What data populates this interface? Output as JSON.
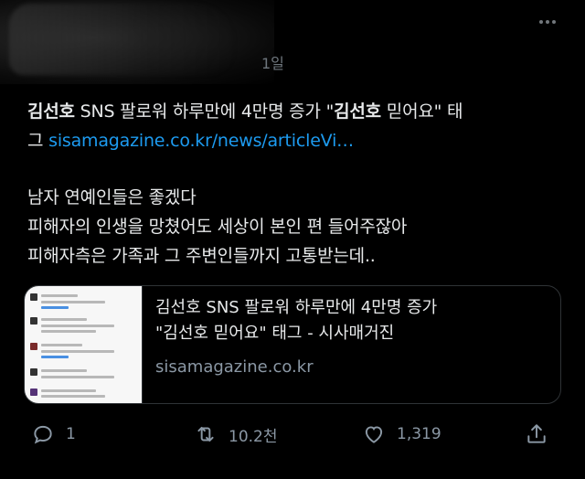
{
  "tweet": {
    "time": "1일",
    "text": {
      "line1_a": "김선호",
      "line1_b": " SNS 팔로워 하루만에 4만명 증가 \"",
      "line1_c": "김선호",
      "line1_d": " 믿어요\" 태",
      "line2_a": "그 ",
      "line2_link": "sisamagazine.co.kr/news/articleVi…",
      "line3": "남자 연예인들은 좋겠다",
      "line4": "피해자의 인생을 망쳤어도 세상이 본인 편 들어주잖아",
      "line5": "피해자측은 가족과 그 주변인들까지 고통받는데.."
    },
    "card": {
      "title_line1": "김선호 SNS 팔로워 하루만에 4만명 증가",
      "title_line2": "\"김선호 믿어요\" 태그 - 시사매거진",
      "domain": "sisamagazine.co.kr"
    },
    "actions": {
      "reply_count": "1",
      "retweet_count": "10.2천",
      "like_count": "1,319"
    }
  },
  "colors": {
    "background": "#000000",
    "text": "#e7e9ea",
    "link": "#1d9bf0",
    "muted": "#8b98a5"
  }
}
